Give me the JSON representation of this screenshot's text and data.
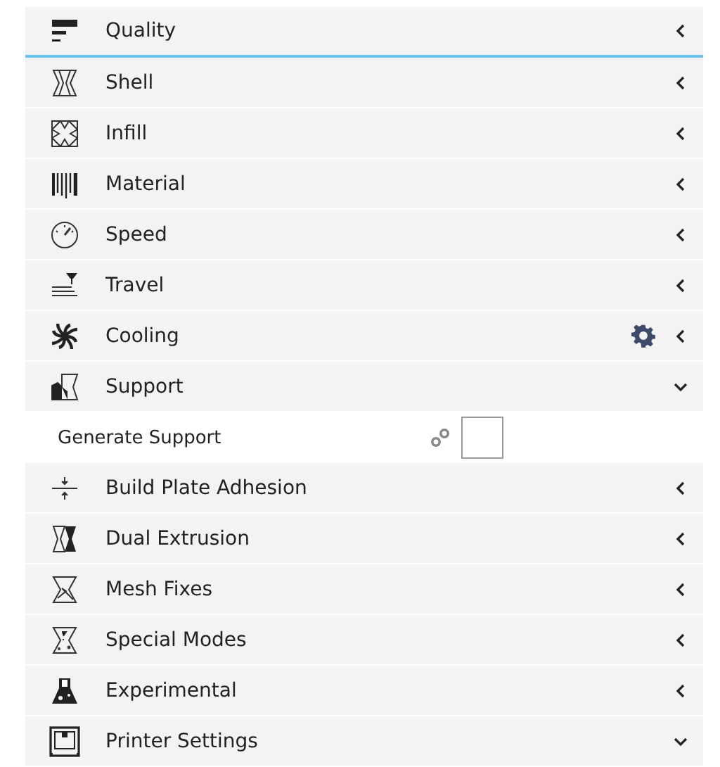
{
  "categories": [
    {
      "label": "Quality",
      "expanded": false,
      "selected": true,
      "settings_shown": false
    },
    {
      "label": "Shell",
      "expanded": false,
      "selected": false,
      "settings_shown": false
    },
    {
      "label": "Infill",
      "expanded": false,
      "selected": false,
      "settings_shown": false
    },
    {
      "label": "Material",
      "expanded": false,
      "selected": false,
      "settings_shown": false
    },
    {
      "label": "Speed",
      "expanded": false,
      "selected": false,
      "settings_shown": false
    },
    {
      "label": "Travel",
      "expanded": false,
      "selected": false,
      "settings_shown": false
    },
    {
      "label": "Cooling",
      "expanded": false,
      "selected": false,
      "settings_shown": true
    },
    {
      "label": "Support",
      "expanded": true,
      "selected": false,
      "settings_shown": false,
      "children": [
        {
          "label": "Generate Support",
          "linked": true,
          "checked": false
        }
      ]
    },
    {
      "label": "Build Plate Adhesion",
      "expanded": false,
      "selected": false,
      "settings_shown": false
    },
    {
      "label": "Dual Extrusion",
      "expanded": false,
      "selected": false,
      "settings_shown": false
    },
    {
      "label": "Mesh Fixes",
      "expanded": false,
      "selected": false,
      "settings_shown": false
    },
    {
      "label": "Special Modes",
      "expanded": false,
      "selected": false,
      "settings_shown": false
    },
    {
      "label": "Experimental",
      "expanded": false,
      "selected": false,
      "settings_shown": false
    },
    {
      "label": "Printer Settings",
      "expanded": true,
      "selected": false,
      "settings_shown": false
    }
  ]
}
